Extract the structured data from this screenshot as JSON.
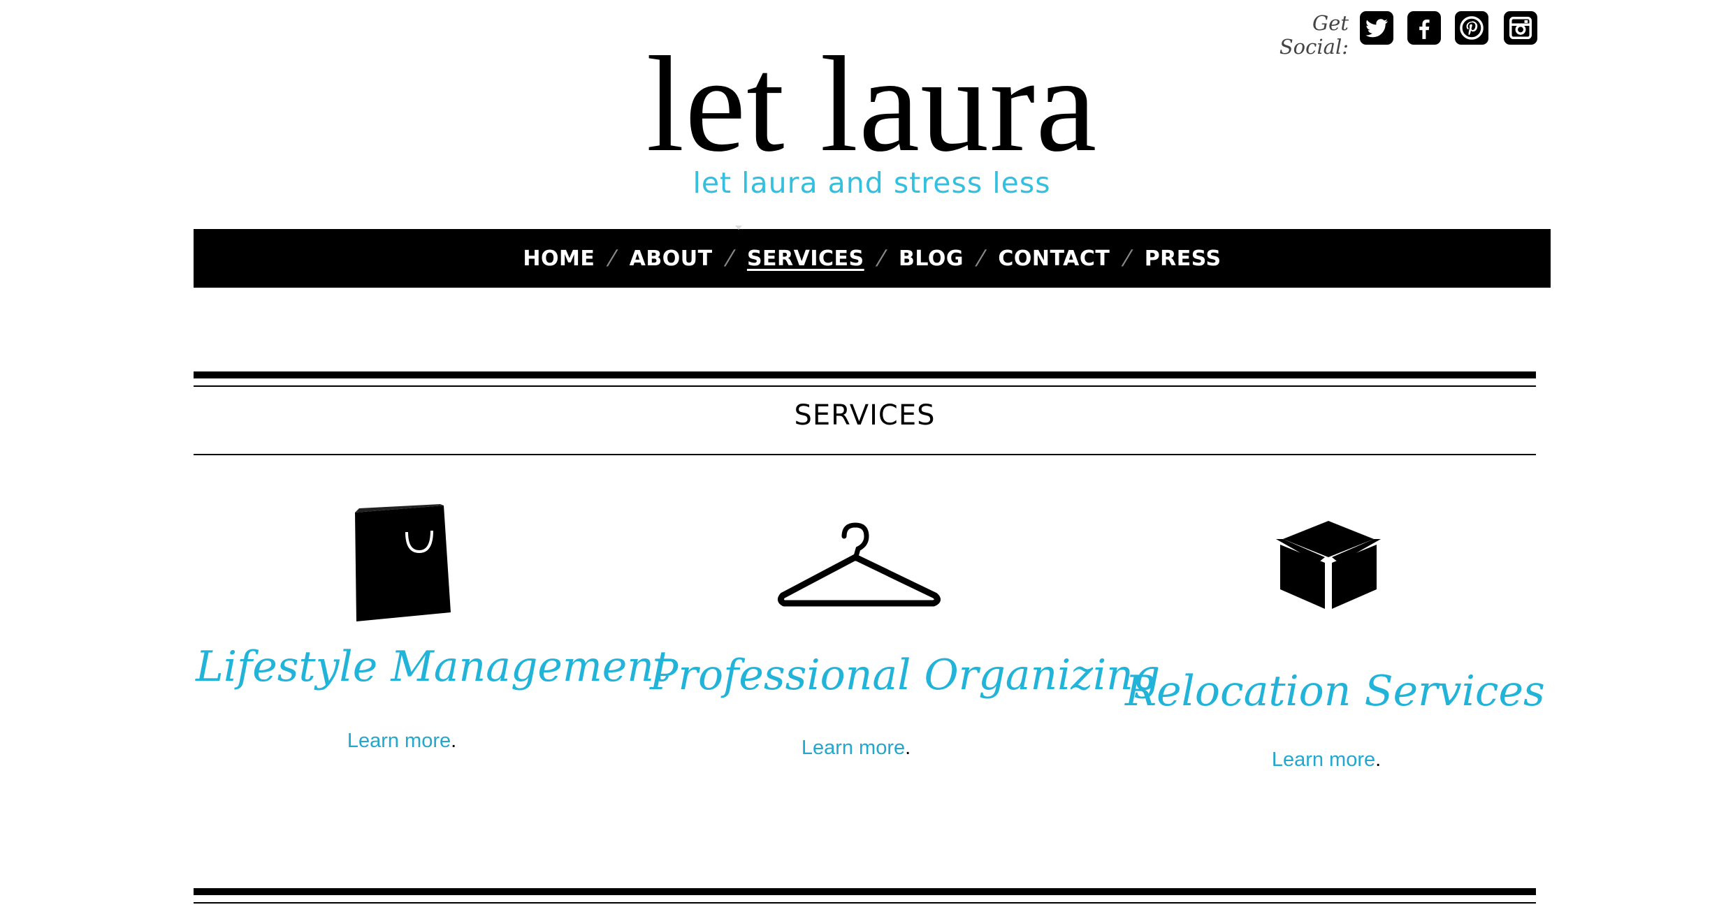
{
  "social": {
    "label": "Get Social:",
    "icons": [
      "twitter-icon",
      "facebook-icon",
      "pinterest-icon",
      "instagram-icon"
    ]
  },
  "logo": {
    "name": "let laura",
    "tagline": "let laura and stress less"
  },
  "nav": {
    "items": [
      {
        "label": "HOME"
      },
      {
        "label": "ABOUT"
      },
      {
        "label": "SERVICES",
        "active": true
      },
      {
        "label": "BLOG"
      },
      {
        "label": "CONTACT"
      },
      {
        "label": "PRESS"
      }
    ],
    "separator": "⁄"
  },
  "section": {
    "title": "SERVICES"
  },
  "services": [
    {
      "icon": "shopping-bag-icon",
      "title": "Lifestyle Management",
      "link": "Learn more",
      "suffix": "."
    },
    {
      "icon": "hanger-icon",
      "title": "Professional Organizing",
      "link": "Learn more",
      "suffix": "."
    },
    {
      "icon": "box-icon",
      "title": "Relocation Services",
      "link": "Learn more",
      "suffix": "."
    }
  ],
  "colors": {
    "accent": "#33bfde",
    "link": "#22a7cf",
    "nav_bg": "#000000"
  }
}
